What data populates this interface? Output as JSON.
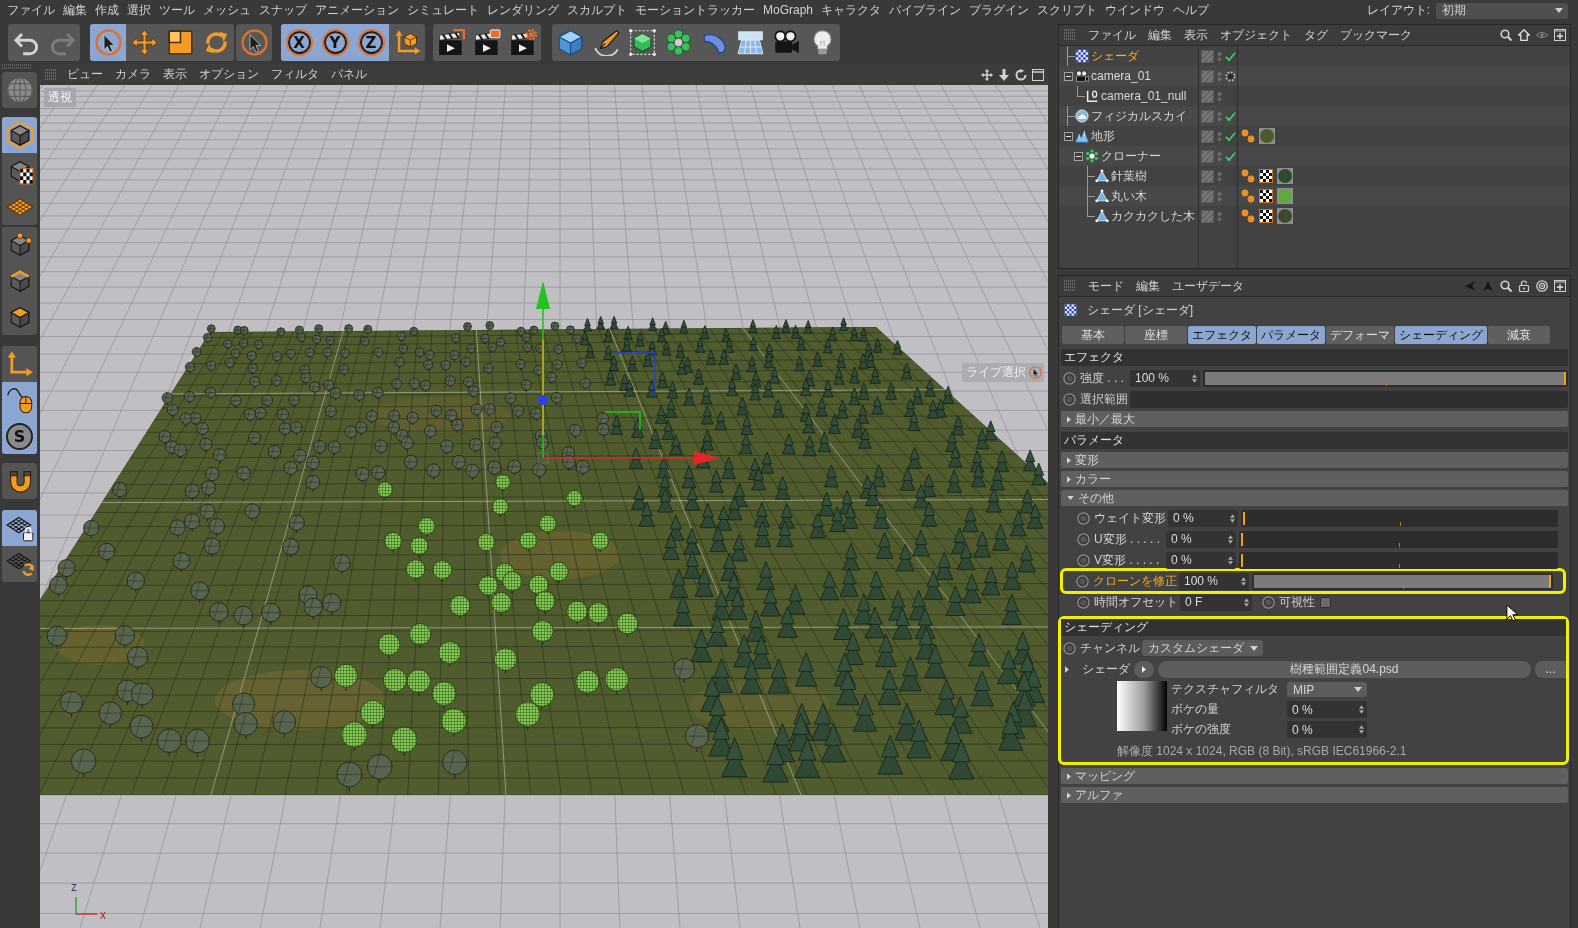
{
  "menu_bar": {
    "items": [
      "ファイル",
      "編集",
      "作成",
      "選択",
      "ツール",
      "メッシュ",
      "スナップ",
      "アニメーション",
      "シミュレート",
      "レンダリング",
      "スカルプト",
      "モーショントラッカー",
      "MoGraph",
      "キャラクタ",
      "パイプライン",
      "プラグイン",
      "スクリプト",
      "ウインドウ",
      "ヘルプ"
    ],
    "layout": {
      "label": "レイアウト:",
      "value": "初期"
    }
  },
  "toolbar": {
    "groups": [
      [
        {
          "selected": false,
          "disabled": false
        },
        {
          "selected": false,
          "disabled": true
        }
      ],
      [
        {
          "selected": true
        },
        {
          "selected": false
        },
        {
          "selected": false
        },
        {
          "selected": false
        }
      ],
      [
        {
          "selected": false
        }
      ],
      [
        {
          "label": "X",
          "selected": true
        },
        {
          "label": "Y",
          "selected": true
        },
        {
          "label": "Z",
          "selected": true
        },
        {
          "selected": false
        }
      ],
      [
        {
          "selected": false
        },
        {
          "selected": false
        },
        {
          "selected": false
        }
      ],
      [
        {
          "selected": false
        },
        {
          "selected": false
        },
        {
          "selected": false
        },
        {
          "selected": false
        },
        {
          "selected": false
        },
        {
          "selected": false
        },
        {
          "selected": false
        },
        {
          "selected": false
        }
      ]
    ]
  },
  "tool_palette": {
    "groups": [
      [
        {
          "selected": false
        }
      ],
      [
        {
          "selected": true
        },
        {
          "selected": false
        },
        {
          "selected": false
        }
      ],
      [
        {
          "selected": false
        },
        {
          "selected": false
        },
        {
          "selected": false
        }
      ],
      [
        {
          "selected": false
        },
        {
          "selected": true
        },
        {
          "label": "S",
          "selected": true
        }
      ],
      [
        {
          "selected": false
        }
      ],
      [
        {
          "selected": true
        },
        {
          "selected": false
        }
      ]
    ]
  },
  "viewport": {
    "menu": [
      "ビュー",
      "カメラ",
      "表示",
      "オプション",
      "フィルタ",
      "パネル"
    ],
    "view_name": "透視",
    "tool_hint": "ライブ選択",
    "axes": [
      "z",
      "x"
    ]
  },
  "object_manager": {
    "menu": [
      "ファイル",
      "編集",
      "表示",
      "オブジェクト",
      "タグ",
      "ブックマーク"
    ],
    "objects": [
      {
        "name": "シェーダ",
        "kind": "shader",
        "selected": true,
        "enabled": true
      },
      {
        "name": "camera_01",
        "kind": "camera",
        "selected": false,
        "enabled": false,
        "expanded": true,
        "children": [
          {
            "name": "camera_01_null",
            "kind": "null",
            "selected": false,
            "enabled": false
          }
        ]
      },
      {
        "name": "フィジカルスカイ",
        "kind": "sky",
        "selected": false,
        "enabled": true
      },
      {
        "name": "地形",
        "kind": "landscape",
        "selected": false,
        "enabled": true,
        "expanded": true,
        "tags": [
          {
            "kind": "smoothing"
          },
          {
            "kind": "material",
            "color": "#4b5a2c"
          }
        ],
        "children": [
          {
            "name": "クローナー",
            "kind": "cloner",
            "selected": false,
            "enabled": true,
            "expanded": true,
            "children": [
              {
                "name": "針葉樹",
                "kind": "polygon",
                "selected": false,
                "enabled": false,
                "tags": [
                  {
                    "kind": "smoothing"
                  },
                  {
                    "kind": "texture"
                  },
                  {
                    "kind": "material",
                    "color": "#2e4a33"
                  }
                ]
              },
              {
                "name": "丸い木",
                "kind": "polygon",
                "selected": false,
                "enabled": false,
                "tags": [
                  {
                    "kind": "smoothing"
                  },
                  {
                    "kind": "texture"
                  },
                  {
                    "kind": "material",
                    "color": "#5faa3c"
                  }
                ]
              },
              {
                "name": "カクカクした木",
                "kind": "polygon",
                "selected": false,
                "enabled": false,
                "tags": [
                  {
                    "kind": "smoothing"
                  },
                  {
                    "kind": "texture"
                  },
                  {
                    "kind": "material",
                    "color": "#3d4a2e"
                  }
                ]
              }
            ]
          }
        ]
      }
    ]
  },
  "attribute_manager": {
    "menu": [
      "モード",
      "編集",
      "ユーザデータ"
    ],
    "title": "シェーダ [シェーダ]",
    "tabs": [
      {
        "label": "基本",
        "selected": false
      },
      {
        "label": "座標",
        "selected": false
      },
      {
        "label": "エフェクタ",
        "selected": true
      },
      {
        "label": "パラメータ",
        "selected": true
      },
      {
        "label": "デフォーマ",
        "selected": false
      },
      {
        "label": "シェーディング",
        "selected": true
      },
      {
        "label": "減衰",
        "selected": false
      }
    ],
    "sections": [
      {
        "title": "エフェクタ",
        "highlighted": false,
        "items": [
          {
            "kind": "slider",
            "label": "強度 . . .",
            "value": "100 %",
            "level": 1
          },
          {
            "kind": "link",
            "label": "選択範囲"
          },
          {
            "kind": "group",
            "label": "最小／最大",
            "expanded": false
          }
        ]
      },
      {
        "title": "パラメータ",
        "highlighted": false,
        "items": [
          {
            "kind": "group",
            "label": "変形",
            "expanded": false
          },
          {
            "kind": "group",
            "label": "カラー",
            "expanded": false
          },
          {
            "kind": "group",
            "label": "その他",
            "expanded": true,
            "items": [
              {
                "kind": "slider",
                "label": "ウェイト変形",
                "value": "0 %",
                "level": 0,
                "accent": false,
                "highlighted": false
              },
              {
                "kind": "slider",
                "label": "U変形 . . . . .",
                "value": "0 %",
                "level": 0,
                "accent": false,
                "highlighted": false
              },
              {
                "kind": "slider",
                "label": "V変形 . . . . .",
                "value": "0 %",
                "level": 0,
                "accent": false,
                "highlighted": false
              },
              {
                "kind": "slider",
                "label": "クローンを修正",
                "value": "100 %",
                "level": 1,
                "accent": true,
                "highlighted": true
              },
              {
                "kind": "offset",
                "label": "時間オフセット",
                "value": "0 F",
                "accent": false,
                "highlighted": false,
                "toggle": {
                  "label": "可視性",
                  "checked": false
                }
              }
            ]
          }
        ]
      },
      {
        "title": "シェーディング",
        "highlighted": true,
        "items": [
          {
            "kind": "dropdown",
            "label": "チャンネル",
            "value": "カスタムシェーダ"
          },
          {
            "kind": "shader",
            "label": "シェーダ",
            "file": "樹種範囲定義04.psd",
            "browse": "...",
            "settings": [
              {
                "kind": "dropdown",
                "label": "テクスチャフィルタ",
                "value": "MIP"
              },
              {
                "kind": "number",
                "label": "ボケの量",
                "value": "0 %"
              },
              {
                "kind": "number",
                "label": "ボケの強度",
                "value": "0 %"
              }
            ],
            "info": "解像度 1024 x 1024, RGB (8 Bit), sRGB IEC61966-2.1"
          }
        ],
        "groups": [
          {
            "kind": "group",
            "label": "マッピング",
            "expanded": false
          },
          {
            "kind": "group",
            "label": "アルファ",
            "expanded": false
          }
        ]
      }
    ]
  }
}
